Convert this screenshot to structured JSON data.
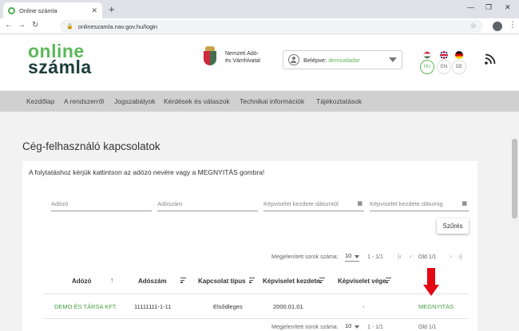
{
  "browser": {
    "tab_title": "Online számla",
    "new_tab": "+",
    "url": "onlineszamla.nav.gov.hu/login",
    "window_minimize": "—",
    "window_maximize": "❐",
    "window_close": "✕",
    "tab_close": "✕",
    "back": "←",
    "forward": "→",
    "reload": "↻",
    "lock": "🔒",
    "star": "☆",
    "menu": "⋮"
  },
  "header": {
    "logo_line1": "online",
    "logo_line2": "számla",
    "agency_line1": "Nemzeti Adó-",
    "agency_line2": "és Vámhivatal",
    "login_label": "Belépve:",
    "login_user": "demoaladar",
    "languages": [
      {
        "code": "HU",
        "active": true
      },
      {
        "code": "EN",
        "active": false
      },
      {
        "code": "DE",
        "active": false
      }
    ]
  },
  "menu": [
    "Kezdőlap",
    "A rendszerről",
    "Jogszabályok",
    "Kérdések és válaszok",
    "Technikai információk",
    "Tájékoztatások"
  ],
  "page": {
    "title": "Cég-felhasználó kapcsolatok",
    "instruction": "A folytatáshoz kérjük kattintson az adózó nevére vagy a MEGNYITÁS gombra!"
  },
  "filters": {
    "adozo": "Adózó",
    "adoszam": "Adószám",
    "date_from": "Képviselet kezdete dátumtól",
    "date_to": "Képviselet kezdete dátumig",
    "button": "Szűrés"
  },
  "pagination": {
    "label": "Megjelenített sorok száma:",
    "page_size": "10",
    "range": "1 - 1/1",
    "range_partial": "Old   1/1"
  },
  "table": {
    "columns": [
      "Adózó",
      "Adószám",
      "Kapcsolat típus",
      "Képviselet kezdete",
      "Képviselet vége"
    ],
    "rows": [
      {
        "adozo": "DEMO ÉS TÁRSA KFT.",
        "adoszam": "11111111-1-11",
        "tipus": "Elsődleges",
        "kezdete": "2000.01.01.",
        "vege": "-",
        "action": "MEGNYITÁS"
      }
    ]
  },
  "colors": {
    "brand_green": "#5cb85c",
    "arrow_red": "#e30613"
  }
}
